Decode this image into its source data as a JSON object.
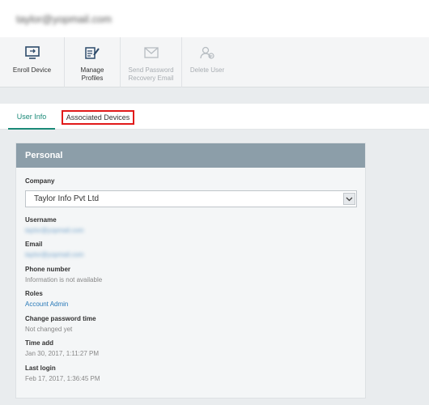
{
  "header": {
    "email": "taylor@yopmail.com"
  },
  "toolbar": {
    "enroll_label": "Enroll Device",
    "manage_label": "Manage\nProfiles",
    "send_label": "Send Password\nRecovery Email",
    "delete_label": "Delete User"
  },
  "icons": {
    "enroll": "enroll-device-icon",
    "manage": "manage-profiles-icon",
    "send": "email-envelope-icon",
    "delete": "delete-user-icon"
  },
  "tabs": {
    "user_info": "User Info",
    "associated_devices": "Associated Devices"
  },
  "personal": {
    "title": "Personal",
    "company_label": "Company",
    "company_value": "Taylor Info Pvt Ltd",
    "username_label": "Username",
    "username_value": "taylor@yopmail.com",
    "email_label": "Email",
    "email_value": "taylor@yopmail.com",
    "phone_label": "Phone number",
    "phone_value": "Information is not available",
    "roles_label": "Roles",
    "roles_value": "Account Admin",
    "pwd_label": "Change password time",
    "pwd_value": "Not changed yet",
    "time_add_label": "Time add",
    "time_add_value": "Jan 30, 2017, 1:11:27 PM",
    "last_login_label": "Last login",
    "last_login_value": "Feb 17, 2017, 1:36:45 PM"
  },
  "colors": {
    "accent": "#1a8a78",
    "link": "#2a7ab8",
    "panel_header": "#8c9ea9",
    "highlight": "#e11a1a"
  }
}
